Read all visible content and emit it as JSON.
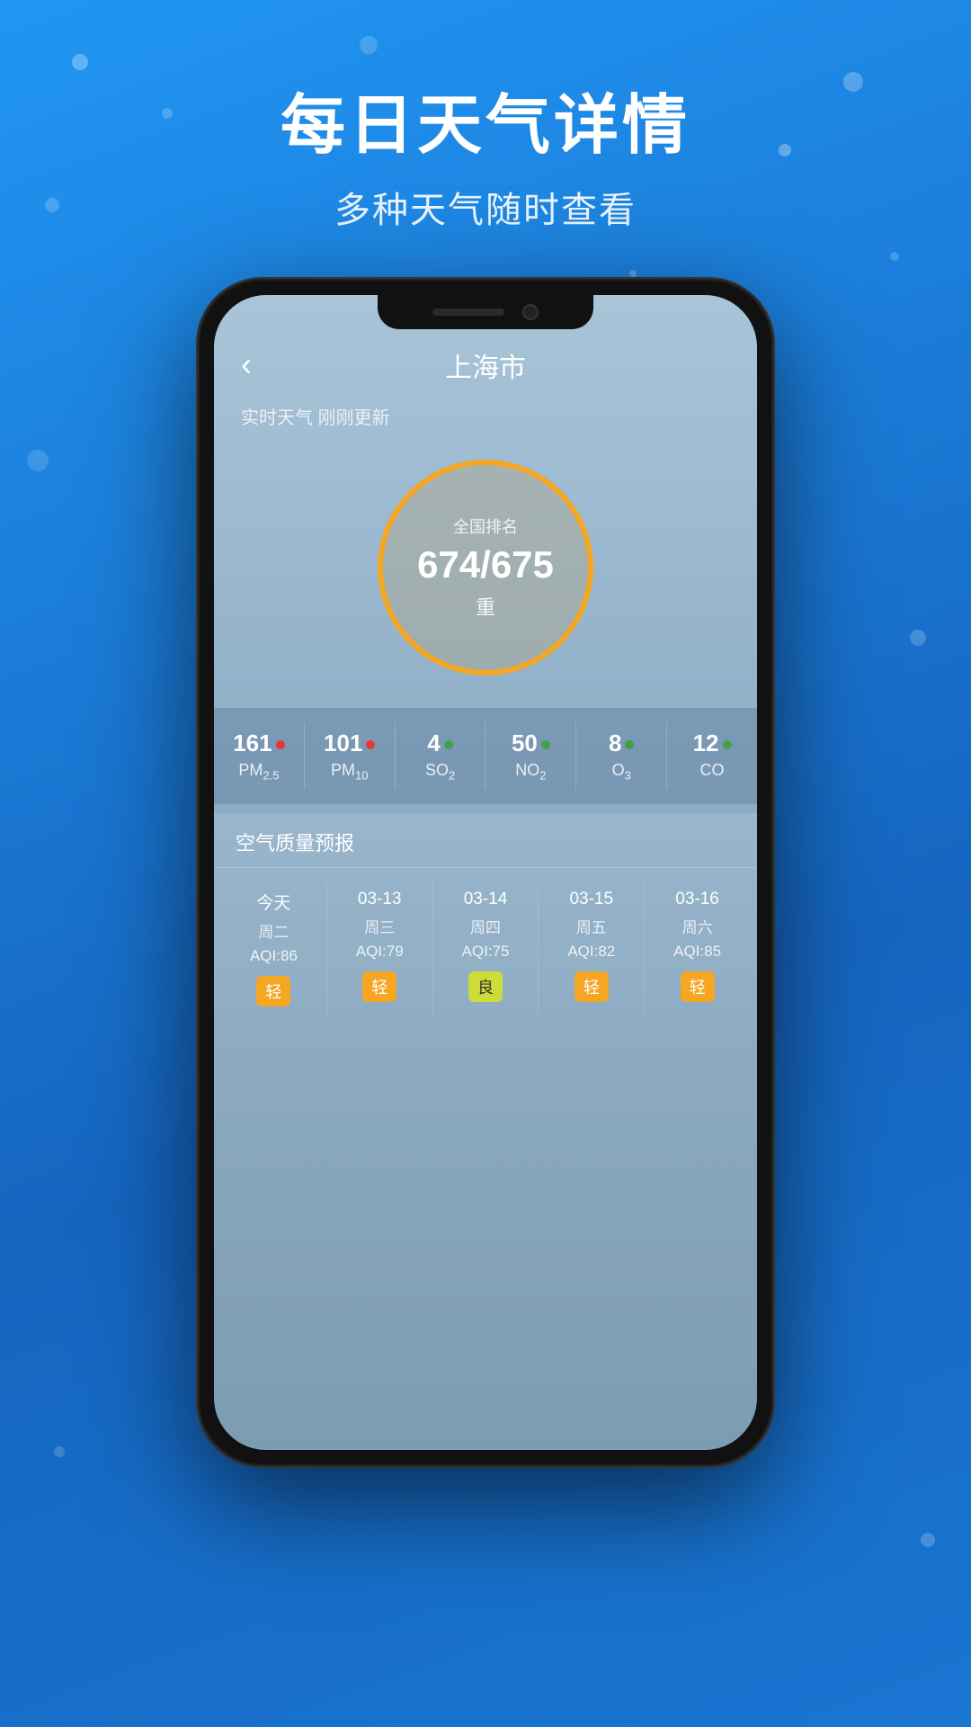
{
  "background": {
    "color_top": "#2196F3",
    "color_bottom": "#1565C0"
  },
  "header": {
    "title": "每日天气详情",
    "subtitle": "多种天气随时查看"
  },
  "app": {
    "back_label": "‹",
    "city": "上海市",
    "status": "实时天气 刚刚更新",
    "aqi_rank_label": "全国排名",
    "aqi_rank_value": "674/675",
    "aqi_level": "重"
  },
  "pollutants": [
    {
      "value": "161",
      "dot_class": "dot-red",
      "name": "PM",
      "sub": "2.5"
    },
    {
      "value": "101",
      "dot_class": "dot-red",
      "name": "PM",
      "sub": "10"
    },
    {
      "value": "4",
      "dot_class": "dot-green",
      "name": "SO",
      "sub": "2"
    },
    {
      "value": "50",
      "dot_class": "dot-green",
      "name": "NO",
      "sub": "2"
    },
    {
      "value": "8",
      "dot_class": "dot-green",
      "name": "O",
      "sub": "3"
    },
    {
      "value": "12",
      "dot_class": "dot-green",
      "name": "CO",
      "sub": ""
    }
  ],
  "forecast": {
    "section_title": "空气质量预报",
    "columns": [
      {
        "date": "今天",
        "day": "周二",
        "aqi": "AQI:86",
        "badge": "轻",
        "badge_class": "badge-orange"
      },
      {
        "date": "03-13",
        "day": "周三",
        "aqi": "AQI:79",
        "badge": "轻",
        "badge_class": "badge-orange"
      },
      {
        "date": "03-14",
        "day": "周四",
        "aqi": "AQI:75",
        "badge": "良",
        "badge_class": "badge-yellow"
      },
      {
        "date": "03-15",
        "day": "周五",
        "aqi": "AQI:82",
        "badge": "轻",
        "badge_class": "badge-orange"
      },
      {
        "date": "03-16",
        "day": "周六",
        "aqi": "AQI:85",
        "badge": "轻",
        "badge_class": "badge-orange"
      }
    ]
  }
}
